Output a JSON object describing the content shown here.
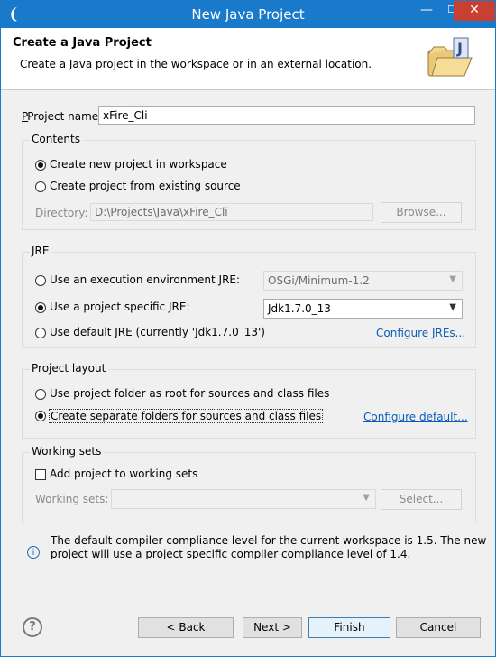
{
  "window": {
    "title": "New Java Project"
  },
  "titlebar": {
    "min_label": "—",
    "max_label": "☐",
    "close_label": "✕"
  },
  "header": {
    "title": "Create a Java Project",
    "description": "Create a Java project in the workspace or in an external location."
  },
  "project_name": {
    "label": "Project name:",
    "value": "xFire_Cli"
  },
  "contents": {
    "title": "Contents",
    "option_new": "Create new project in workspace",
    "option_existing": "Create project from existing source",
    "directory_label": "Directory:",
    "directory_value": "D:\\Projects\\Java\\xFire_Cli",
    "browse_label": "Browse..."
  },
  "jre": {
    "title": "JRE",
    "option_env": "Use an execution environment JRE:",
    "env_value": "OSGi/Minimum-1.2",
    "option_specific": "Use a project specific JRE:",
    "specific_value": "Jdk1.7.0_13",
    "option_default": "Use default JRE (currently 'Jdk1.7.0_13')",
    "configure_link": "Configure JREs..."
  },
  "layout": {
    "title": "Project layout",
    "option_root": "Use project folder as root for sources and class files",
    "option_separate": "Create separate folders for sources and class files",
    "configure_link": "Configure default..."
  },
  "working_sets": {
    "title": "Working sets",
    "add_label": "Add project to working sets",
    "sets_label": "Working sets:",
    "sets_value": "",
    "select_label": "Select..."
  },
  "info": {
    "line1": "The default compiler compliance level for the current workspace is 1.5. The new",
    "line2": "project will use a project specific compiler compliance level of 1.4."
  },
  "buttons": {
    "back": "< Back",
    "next": "Next >",
    "finish": "Finish",
    "cancel": "Cancel"
  },
  "icons": {
    "info": "info-icon",
    "help": "help-icon",
    "banner": "java-project-banner-icon"
  }
}
